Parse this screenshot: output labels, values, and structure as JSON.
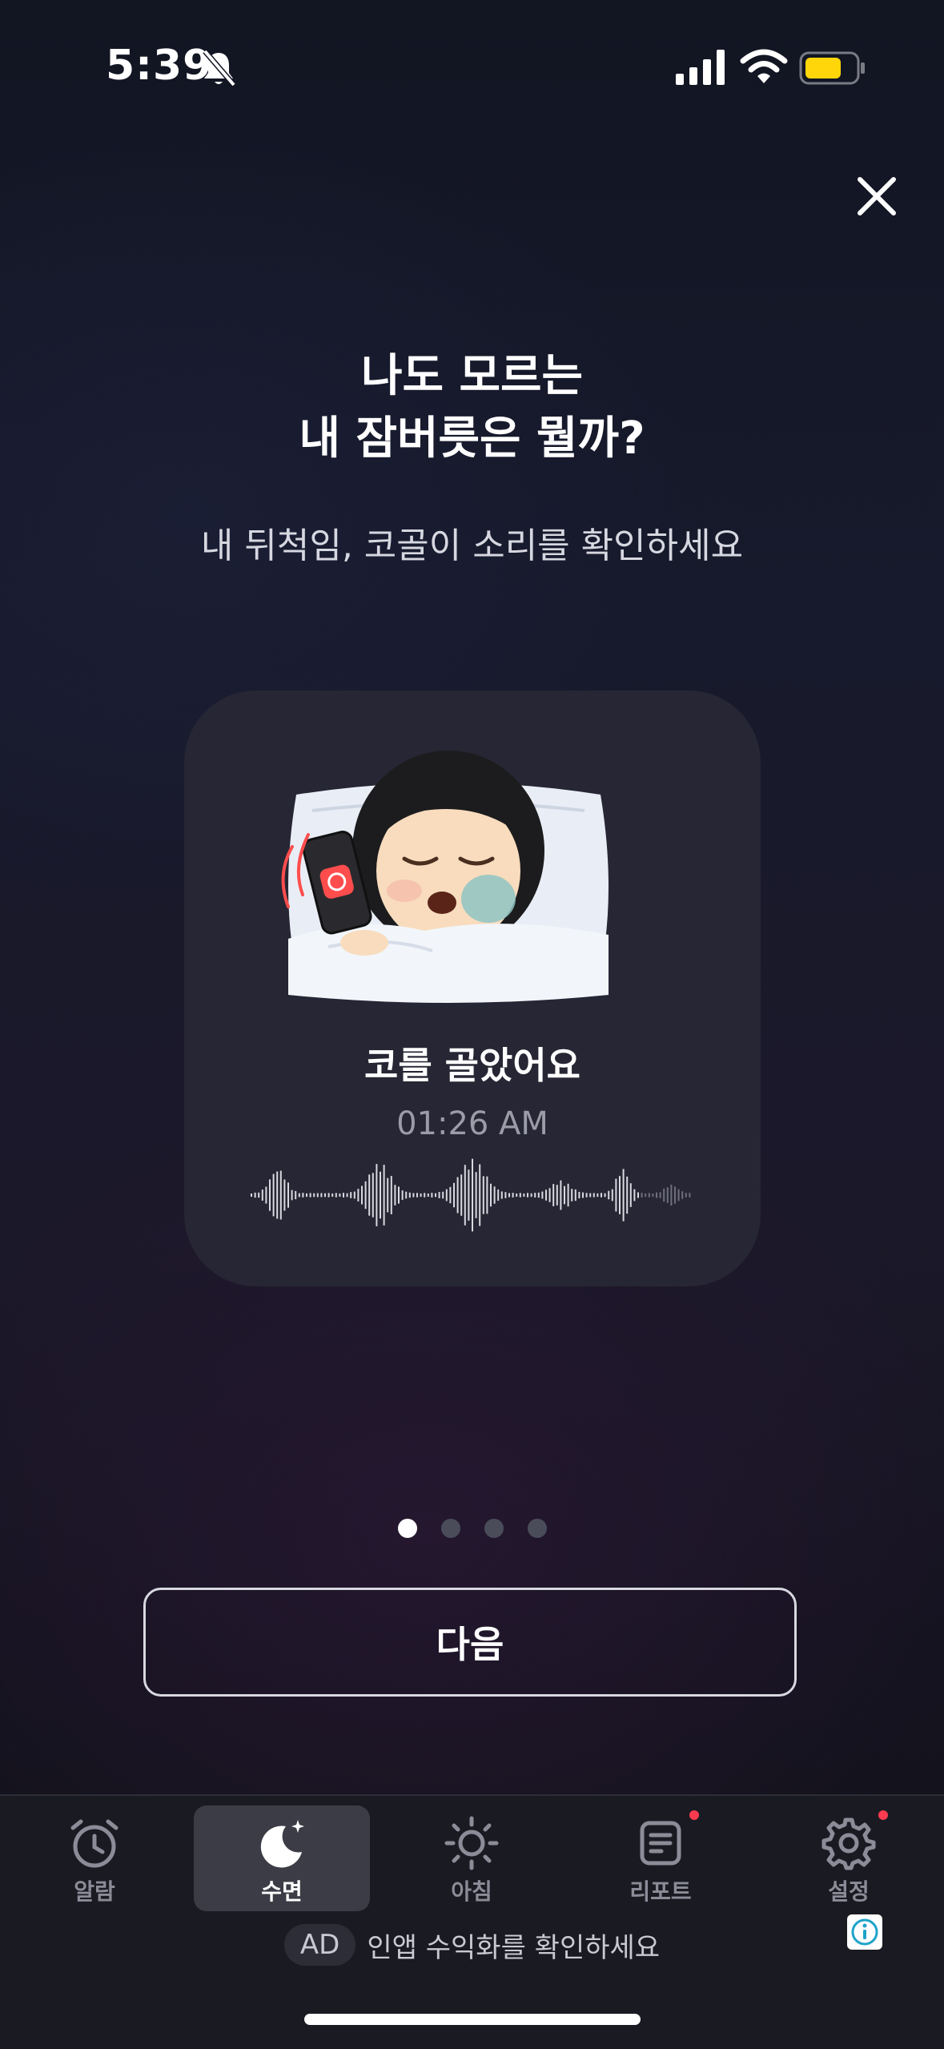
{
  "status_bar": {
    "time": "5:39"
  },
  "onboarding": {
    "headline_line1": "나도 모르는",
    "headline_line2": "내 잠버릇은 뭘까?",
    "subtitle": "내 뒤척임, 코골이 소리를 확인하세요",
    "card": {
      "event_title": "코를 골았어요",
      "event_time": "01:26 AM"
    },
    "page_indicator": {
      "total": 4,
      "current": 1
    },
    "next_button": "다음"
  },
  "tab_bar": {
    "items": [
      {
        "label": "알람",
        "icon": "alarm-clock-icon",
        "active": false,
        "badge": false
      },
      {
        "label": "수면",
        "icon": "moon-star-icon",
        "active": true,
        "badge": false
      },
      {
        "label": "아침",
        "icon": "sun-icon",
        "active": false,
        "badge": false
      },
      {
        "label": "리포트",
        "icon": "report-icon",
        "active": false,
        "badge": true
      },
      {
        "label": "설정",
        "icon": "gear-icon",
        "active": false,
        "badge": true
      }
    ]
  },
  "ad_banner": {
    "badge": "AD",
    "text": "인앱 수익화를 확인하세요"
  },
  "colors": {
    "accent_badge": "#ff3b4f",
    "card_bg": "#262634",
    "battery": "#ffd60a"
  }
}
